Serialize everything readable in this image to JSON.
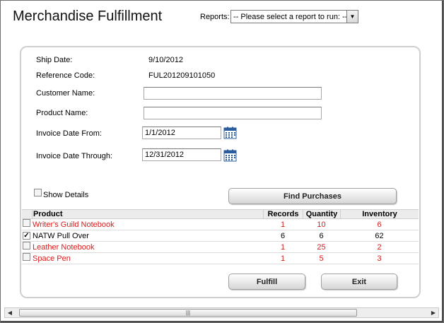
{
  "header": {
    "title": "Merchandise Fulfillment",
    "reports_label": "Reports:",
    "reports_selected": "-- Please select a report to run: --"
  },
  "form": {
    "ship_date_label": "Ship Date:",
    "ship_date_value": "9/10/2012",
    "reference_code_label": "Reference Code:",
    "reference_code_value": "FUL201209101050",
    "customer_name_label": "Customer Name:",
    "customer_name_value": "",
    "product_name_label": "Product Name:",
    "product_name_value": "",
    "invoice_from_label": "Invoice Date From:",
    "invoice_from_value": "1/1/2012",
    "invoice_through_label": "Invoice Date Through:",
    "invoice_through_value": "12/31/2012",
    "show_details_label": "Show Details",
    "show_details_checked": false,
    "find_purchases_label": "Find Purchases"
  },
  "grid": {
    "columns": [
      "Product",
      "Records",
      "Quantity",
      "Inventory"
    ],
    "rows": [
      {
        "product": "Writer's Guild Notebook",
        "records": "1",
        "quantity": "10",
        "inventory": "6",
        "checked": false,
        "color": "#d81b1b"
      },
      {
        "product": "NATW Pull Over",
        "records": "6",
        "quantity": "6",
        "inventory": "62",
        "checked": true,
        "color": "#000000"
      },
      {
        "product": "Leather Notebook",
        "records": "1",
        "quantity": "25",
        "inventory": "2",
        "checked": false,
        "color": "#d81b1b"
      },
      {
        "product": "Space Pen",
        "records": "1",
        "quantity": "5",
        "inventory": "3",
        "checked": false,
        "color": "#d81b1b"
      }
    ]
  },
  "actions": {
    "fulfill_label": "Fulfill",
    "exit_label": "Exit"
  },
  "icons": {
    "calendar": "calendar-icon",
    "dropdown": "chevron-down-icon"
  }
}
